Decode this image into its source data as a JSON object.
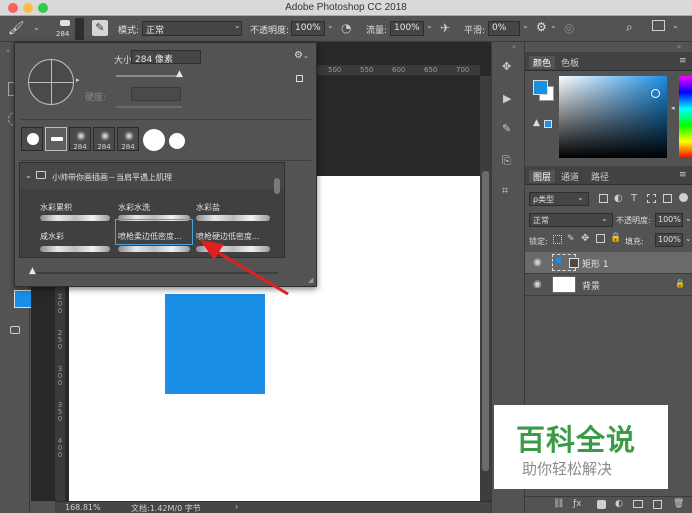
{
  "window": {
    "title": "Adobe Photoshop CC 2018"
  },
  "options_bar": {
    "brush_size_small": "284",
    "mode_label": "模式:",
    "mode_value": "正常",
    "opacity_label": "不透明度:",
    "opacity_value": "100%",
    "flow_label": "流量:",
    "flow_value": "100%",
    "smoothing_label": "平滑:",
    "smoothing_value": "0%"
  },
  "brush_panel": {
    "size_label": "大小:",
    "size_value": "284 像素",
    "hardness_label": "硬度:",
    "tip_numbers": [
      "284",
      "284",
      "284"
    ],
    "folder_name": "小帅带你画插画－当肩平遇上肌理",
    "brushes": [
      "水彩累积",
      "水彩水洗",
      "水彩盐",
      "咸水彩",
      "喷枪柔边低密度...",
      "喷枪硬边低密度..."
    ]
  },
  "ruler": {
    "top": [
      "500",
      "550",
      "600",
      "650",
      "700"
    ],
    "left": [
      "2 0 0",
      "2 5 0",
      "3 0 0",
      "3 5 0",
      "4 0 0"
    ]
  },
  "status": {
    "zoom": "168.81%",
    "doc": "文档:1.42M/0 字节"
  },
  "color_panel": {
    "tabs": [
      "颜色",
      "色板"
    ],
    "fg_color": "#1a8fe6"
  },
  "layers_panel": {
    "tabs": [
      "图层",
      "通道",
      "路径"
    ],
    "filter": "ρ类型",
    "blend_mode": "正常",
    "opacity_label": "不透明度:",
    "opacity_value": "100%",
    "lock_label": "锁定:",
    "fill_label": "填充:",
    "fill_value": "100%",
    "layers": [
      {
        "name": "矩形 1"
      },
      {
        "name": "背景"
      }
    ]
  },
  "watermark": {
    "title": "百科全说",
    "subtitle": "助你轻松解决"
  }
}
